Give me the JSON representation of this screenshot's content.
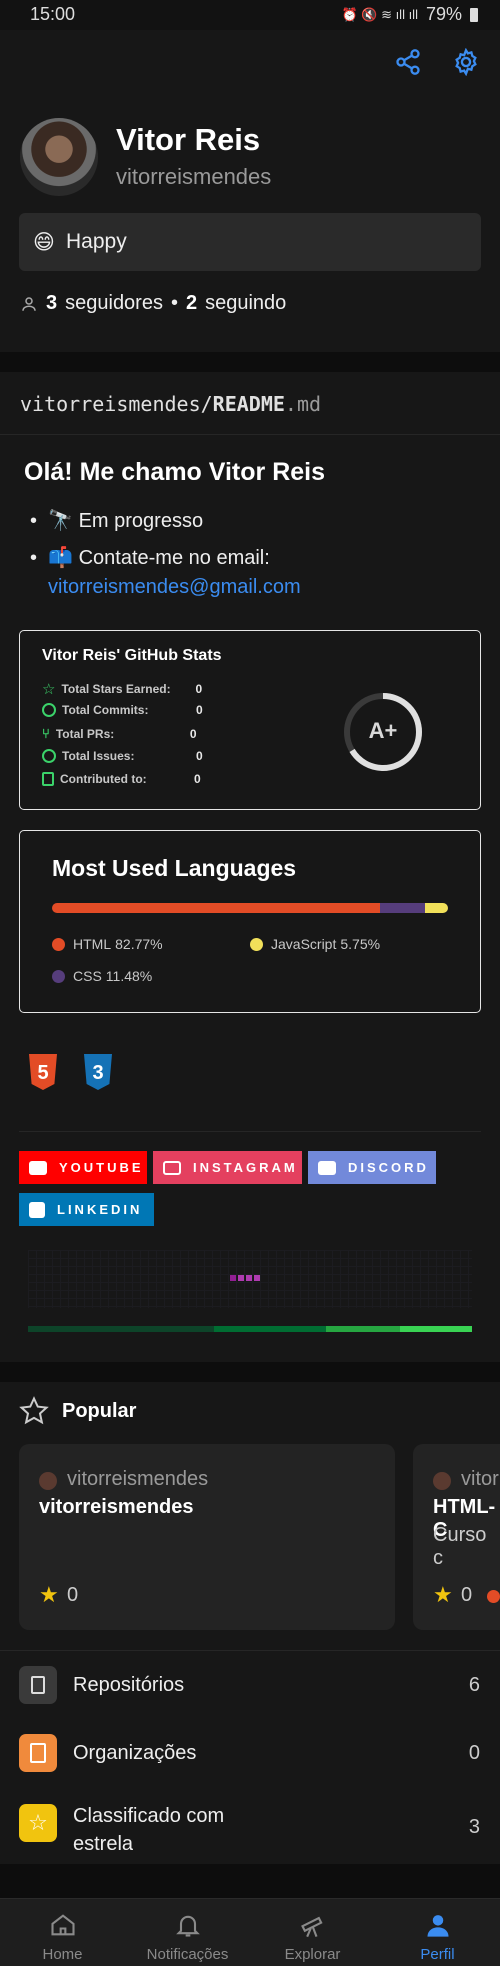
{
  "status_bar": {
    "time": "15:00",
    "battery": "79%"
  },
  "profile": {
    "name": "Vitor Reis",
    "login": "vitorreismendes",
    "status_emoji": "😄",
    "status_text": "Happy",
    "followers_count": "3",
    "followers_label": "seguidores",
    "separator": "•",
    "following_count": "2",
    "following_label": "seguindo",
    "icons": [
      "share-icon",
      "gear-icon"
    ],
    "accent": "#3b8cf0"
  },
  "readme": {
    "owner": "vitorreismendes",
    "slash": "/",
    "file_name": "README",
    "file_ext": ".md",
    "heading": "Olá! Me chamo Vitor Reis",
    "bullets": [
      {
        "emoji": "🔭",
        "text": "Em progresso"
      },
      {
        "emoji": "📫",
        "text": "Contate-me no email:",
        "link": "vitorreismendes@gmail.com"
      }
    ]
  },
  "stats_card": {
    "title": "Vitor Reis' GitHub Stats",
    "rows": [
      {
        "label": "Total Stars Earned:",
        "value": "0"
      },
      {
        "label": "Total Commits:",
        "value": "0"
      },
      {
        "label": "Total PRs:",
        "value": "0"
      },
      {
        "label": "Total Issues:",
        "value": "0"
      },
      {
        "label": "Contributed to:",
        "value": "0"
      }
    ],
    "grade": "A+",
    "icon_color": "#3bd26a"
  },
  "languages_card": {
    "title": "Most Used Languages",
    "languages": [
      {
        "name": "HTML",
        "percent": "82.77%",
        "value": 82.77,
        "color": "#e34c26"
      },
      {
        "name": "CSS",
        "percent": "11.48%",
        "value": 11.48,
        "color": "#563d7c"
      },
      {
        "name": "JavaScript",
        "percent": "5.75%",
        "value": 5.75,
        "color": "#f1e05a"
      }
    ]
  },
  "tech_icons": [
    "html5-icon",
    "css3-icon"
  ],
  "social_badges": [
    {
      "label": "YOUTUBE",
      "color": "#ff0000",
      "icon": "youtube-icon"
    },
    {
      "label": "INSTAGRAM",
      "color": "#e4405f",
      "icon": "instagram-icon"
    },
    {
      "label": "DISCORD",
      "color": "#7289da",
      "icon": "discord-icon"
    },
    {
      "label": "LINKEDIN",
      "color": "#0077b5",
      "icon": "linkedin-icon"
    }
  ],
  "popular": {
    "title": "Popular",
    "repos": [
      {
        "owner": "vitorreismendes",
        "name": "vitorreismendes",
        "description": "",
        "stars": "0"
      },
      {
        "owner": "vitor",
        "name": "HTML-C",
        "description": "Curso c",
        "stars": "0",
        "language_color": "#e34c26"
      }
    ]
  },
  "menu": [
    {
      "label": "Repositórios",
      "count": "6",
      "color": "#3a3a3a",
      "icon": "repo-icon"
    },
    {
      "label": "Organizações",
      "count": "0",
      "color": "#f08a3c",
      "icon": "organization-icon"
    },
    {
      "label": "Classificado com estrela",
      "count": "3",
      "color": "#f1c40f",
      "icon": "star-icon"
    }
  ],
  "bottom_nav": [
    {
      "label": "Home",
      "icon": "home-icon",
      "active": false
    },
    {
      "label": "Notificações",
      "icon": "bell-icon",
      "active": false
    },
    {
      "label": "Explorar",
      "icon": "telescope-icon",
      "active": false
    },
    {
      "label": "Perfil",
      "icon": "person-icon",
      "active": true
    }
  ]
}
